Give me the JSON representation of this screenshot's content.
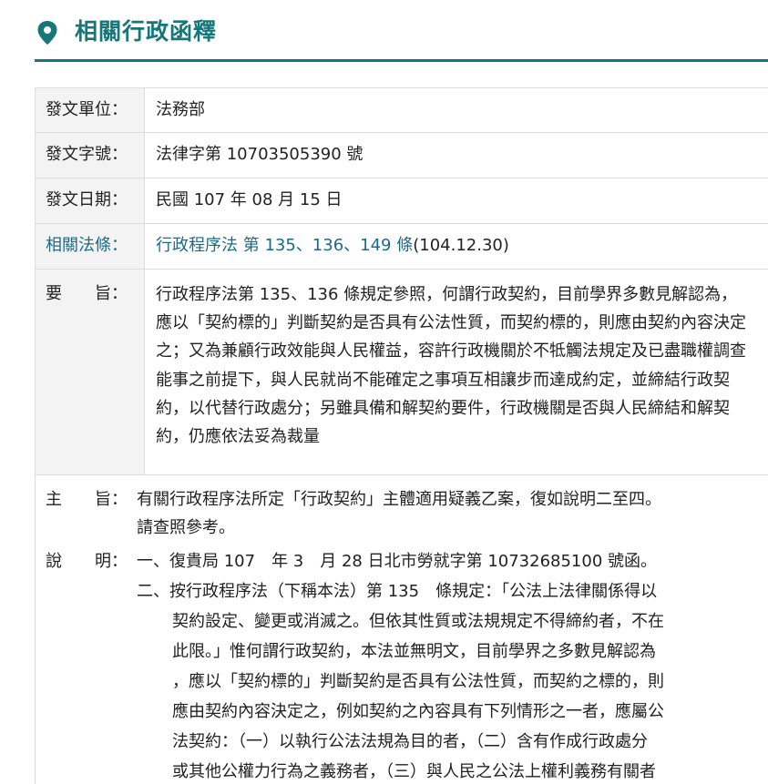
{
  "header": {
    "title": "相關行政函釋",
    "icon": "map-pin-icon",
    "accent_color": "#16777a"
  },
  "info": {
    "issuer": {
      "label": "發文單位：",
      "value": "法務部"
    },
    "doc_no": {
      "label": "發文字號：",
      "value": "法律字第 10703505390 號"
    },
    "date": {
      "label": "發文日期：",
      "value": "民國 107 年 08 月 15 日"
    },
    "law": {
      "label": "相關法條：",
      "link_text": "行政程序法 第 135、136、149 條",
      "suffix": "(104.12.30)"
    },
    "gist": {
      "label": "要　　旨：",
      "text": "行政程序法第 135、136 條規定參照，何謂行政契約，目前學界多數見解認為，應以「契約標的」判斷契約是否具有公法性質，而契約標的，則應由契約內容決定之；又為兼顧行政效能與人民權益，容許行政機關於不牴觸法規定及已盡職權調查能事之前提下，與人民就尚不能確定之事項互相讓步而達成約定，並締結行政契約，以代替行政處分；另雖具備和解契約要件，行政機關是否與人民締結和解契約，仍應依法妥為裁量"
    }
  },
  "body": {
    "subject_label": "主　　旨：",
    "subject_lines": [
      "有關行政程序法所定「行政契約」主體適用疑義乙案，復如說明二至四。",
      "請查照參考。"
    ],
    "explain_label": "說　　明：",
    "item1": "一、復貴局 107　年 3　月 28 日北市勞就字第 10732685100 號函。",
    "item2_lines": [
      "二、按行政程序法（下稱本法）第 135　條規定：「公法上法律關係得以",
      "契約設定、變更或消滅之。但依其性質或法規規定不得締約者，不在",
      "此限。」惟何謂行政契約，本法並無明文，目前學界之多數見解認為",
      "，應以「契約標的」判斷契約是否具有公法性質，而契約之標的，則",
      "應由契約內容決定之，例如契約之內容具有下列情形之一者，應屬公",
      "法契約：（一）以執行公法法規為目的者，（二）含有作成行政處分",
      "或其他公權力行為之義務者，（三）與人民之公法上權利義務有關者"
    ]
  }
}
